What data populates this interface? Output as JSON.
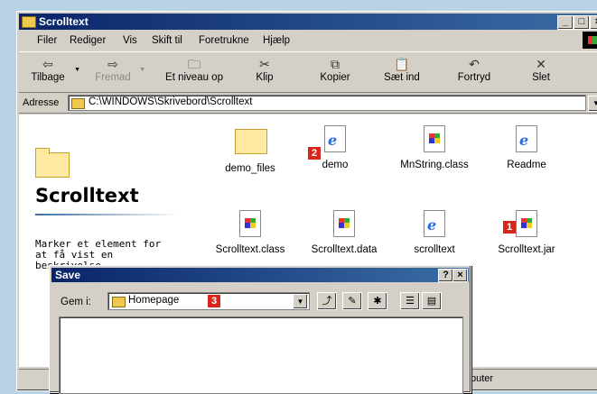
{
  "window": {
    "title": "Scrolltext"
  },
  "menu": [
    "Filer",
    "Rediger",
    "Vis",
    "Skift til",
    "Foretrukne",
    "Hjælp"
  ],
  "toolbar": {
    "back": "Tilbage",
    "forward": "Fremad",
    "up": "Et niveau op",
    "cut": "Klip",
    "copy": "Kopier",
    "paste": "Sæt ind",
    "undo": "Fortryd",
    "delete": "Slet"
  },
  "address": {
    "label": "Adresse",
    "value": "C:\\WINDOWS\\Skrivebord\\Scrolltext"
  },
  "folder": {
    "title": "Scrolltext",
    "description": "Marker et element for at få vist en beskrivelse."
  },
  "files": [
    {
      "name": "demo_files"
    },
    {
      "name": "demo"
    },
    {
      "name": "MnString.class"
    },
    {
      "name": "Readme"
    },
    {
      "name": "Scrolltext.class"
    },
    {
      "name": "Scrolltext.data"
    },
    {
      "name": "scrolltext"
    },
    {
      "name": "Scrolltext.jar"
    }
  ],
  "badges": {
    "one": "1",
    "two": "2",
    "three": "3"
  },
  "status": {
    "text": "puter"
  },
  "dialog": {
    "title": "Save",
    "look_in_label": "Gem i:",
    "look_in_value": "Homepage"
  }
}
